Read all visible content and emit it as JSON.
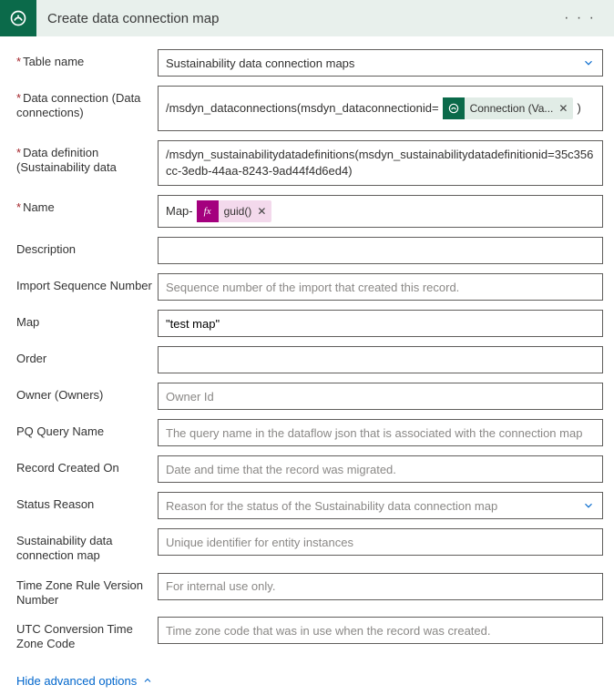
{
  "header": {
    "title": "Create data connection map"
  },
  "fields": {
    "tableName": {
      "label": "Table name",
      "value": "Sustainability data connection maps"
    },
    "dataConnection": {
      "label": "Data connection (Data connections)",
      "textBefore": "/msdyn_dataconnections(msdyn_dataconnectionid=",
      "tokenLabel": "Connection (Va...",
      "textAfter": ")"
    },
    "dataDefinition": {
      "label": "Data definition (Sustainability data",
      "value": "/msdyn_sustainabilitydatadefinitions(msdyn_sustainabilitydatadefinitionid=35c356cc-3edb-44aa-8243-9ad44f4d6ed4)"
    },
    "name": {
      "label": "Name",
      "textBefore": "Map-",
      "tokenIcon": "fx",
      "tokenLabel": "guid()"
    },
    "description": {
      "label": "Description",
      "value": ""
    },
    "importSequence": {
      "label": "Import Sequence Number",
      "placeholder": "Sequence number of the import that created this record."
    },
    "map": {
      "label": "Map",
      "value": "\"test map\""
    },
    "order": {
      "label": "Order",
      "value": ""
    },
    "owner": {
      "label": "Owner (Owners)",
      "placeholder": "Owner Id"
    },
    "pqQueryName": {
      "label": "PQ Query Name",
      "placeholder": "The query name in the dataflow json that is associated with the connection map"
    },
    "recordCreatedOn": {
      "label": "Record Created On",
      "placeholder": "Date and time that the record was migrated."
    },
    "statusReason": {
      "label": "Status Reason",
      "placeholder": "Reason for the status of the Sustainability data connection map"
    },
    "sustainabilityMap": {
      "label": "Sustainability data connection map",
      "placeholder": "Unique identifier for entity instances"
    },
    "tzRule": {
      "label": "Time Zone Rule Version Number",
      "placeholder": "For internal use only."
    },
    "utcCode": {
      "label": "UTC Conversion Time Zone Code",
      "placeholder": "Time zone code that was in use when the record was created."
    }
  },
  "footer": {
    "hideAdvanced": "Hide advanced options"
  }
}
